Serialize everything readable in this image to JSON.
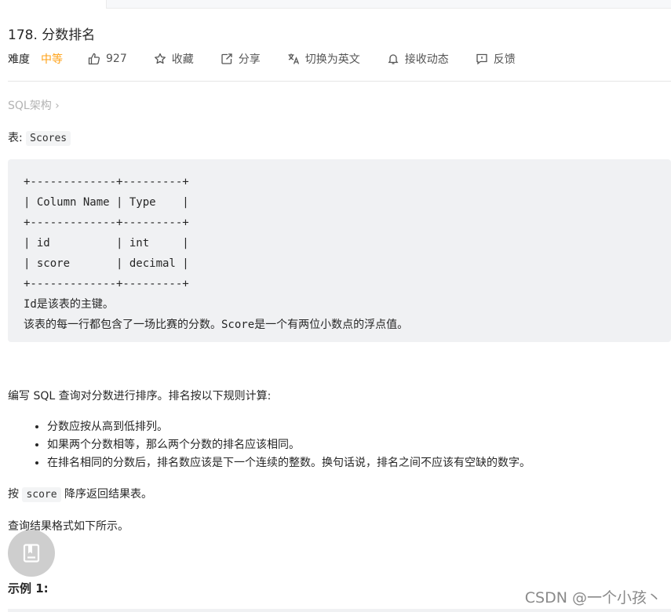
{
  "problem": {
    "title": "178. 分数排名"
  },
  "meta": {
    "difficulty_label": "难度",
    "difficulty_value": "中等",
    "likes": "927",
    "favorite": "收藏",
    "share": "分享",
    "switch_lang": "切换为英文",
    "notify": "接收动态",
    "feedback": "反馈"
  },
  "breadcrumb": {
    "label": "SQL架构",
    "arrow": "›"
  },
  "table_intro": {
    "prefix": "表: ",
    "name": "Scores"
  },
  "schema_block": {
    "lines": [
      "+-------------+---------+",
      "| Column Name | Type    |",
      "+-------------+---------+",
      "| id          | int     |",
      "| score       | decimal |",
      "+-------------+---------+",
      "Id是该表的主键。",
      "该表的每一行都包含了一场比赛的分数。Score是一个有两位小数点的浮点值。"
    ]
  },
  "description": "编写 SQL 查询对分数进行排序。排名按以下规则计算:",
  "rules": [
    "分数应按从高到低排列。",
    "如果两个分数相等，那么两个分数的排名应该相同。",
    "在排名相同的分数后，排名数应该是下一个连续的整数。换句话说，排名之间不应该有空缺的数字。"
  ],
  "order": {
    "prefix": "按 ",
    "code": "score",
    "suffix": " 降序返回结果表。"
  },
  "format_note": "查询结果格式如下所示。",
  "example": {
    "title": "示例 1:"
  },
  "watermark": "CSDN @一个小孩丶",
  "icons": {
    "like": "thumb-up-icon",
    "favorite": "star-icon",
    "share": "share-icon",
    "translate": "translate-icon",
    "notify": "bell-icon",
    "feedback": "feedback-icon",
    "fab": "notebook-icon"
  },
  "colors": {
    "difficulty": "#ffa116",
    "code_bg": "#f0f1f3"
  }
}
